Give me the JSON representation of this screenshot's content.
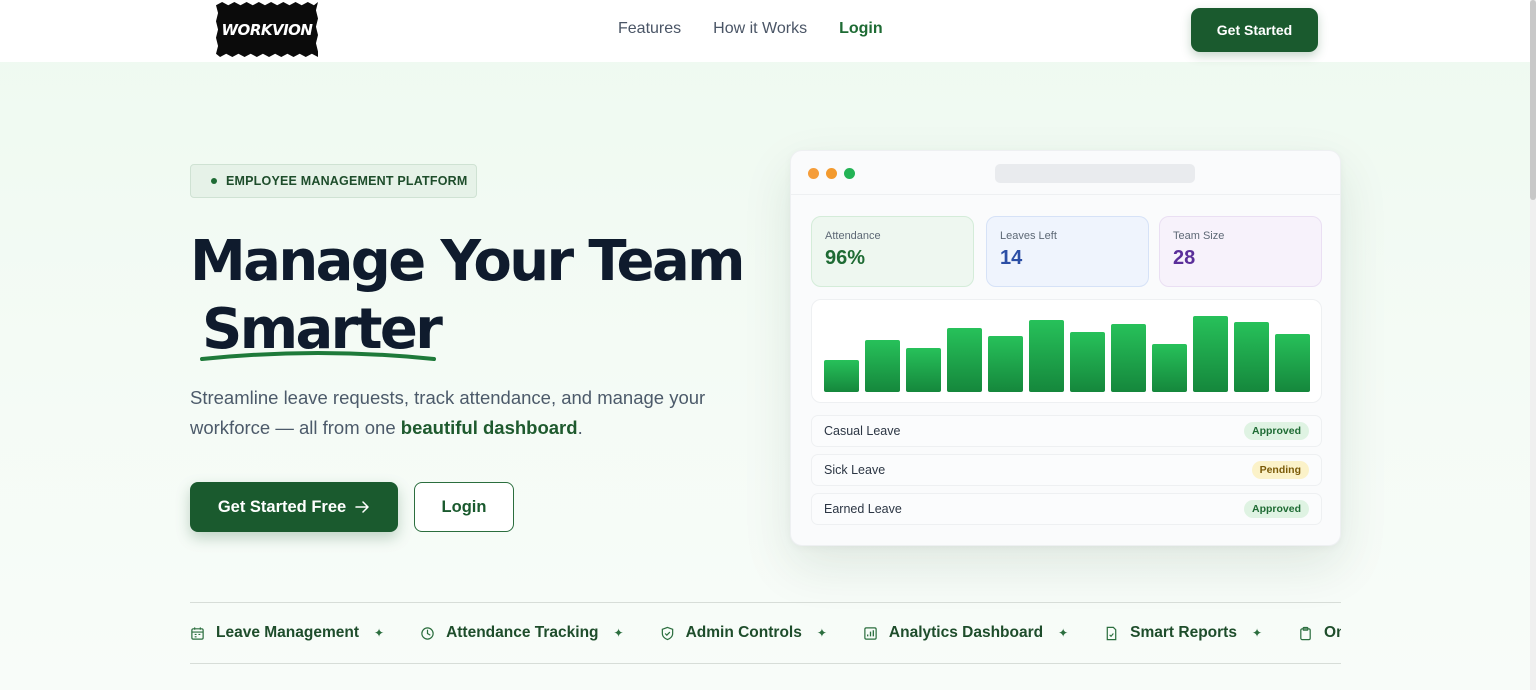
{
  "nav": {
    "logo_text": "WORKVION",
    "links": [
      "Features",
      "How it Works",
      "Login"
    ],
    "cta": "Get Started"
  },
  "hero": {
    "badge": "EMPLOYEE MANAGEMENT PLATFORM",
    "headline_line1": "Manage Your Team",
    "headline_line2": "Smarter",
    "subtext_before": "Streamline leave requests, track attendance, and manage your workforce — all from one ",
    "subtext_highlight": "beautiful dashboard",
    "subtext_after": ".",
    "cta_primary": "Get Started Free",
    "cta_secondary": "Login"
  },
  "dashboard": {
    "stats": [
      {
        "label": "Attendance",
        "value": "96%",
        "color": "#1e6b34"
      },
      {
        "label": "Leaves Left",
        "value": "14",
        "color": "#2b4ea5"
      },
      {
        "label": "Team Size",
        "value": "28",
        "color": "#5b2f9a"
      }
    ],
    "chart_data": {
      "type": "bar",
      "values": [
        32,
        52,
        44,
        64,
        56,
        72,
        60,
        68,
        48,
        76,
        70,
        58
      ],
      "ylim": [
        0,
        80
      ],
      "xlabel": "",
      "ylabel": "",
      "color": "#22a24d"
    },
    "leaves": [
      {
        "name": "Casual Leave",
        "status": "Approved"
      },
      {
        "name": "Sick Leave",
        "status": "Pending"
      },
      {
        "name": "Earned Leave",
        "status": "Approved"
      }
    ]
  },
  "features": [
    {
      "label": "Leave Management",
      "icon": "calendar-icon"
    },
    {
      "label": "Attendance Tracking",
      "icon": "clock-icon"
    },
    {
      "label": "Admin Controls",
      "icon": "shield-icon"
    },
    {
      "label": "Analytics Dashboard",
      "icon": "chart-icon"
    },
    {
      "label": "Smart Reports",
      "icon": "document-icon"
    },
    {
      "label": "One-Cl",
      "icon": "clipboard-icon"
    }
  ],
  "colors": {
    "brand": "#1a5a2e",
    "accent": "#22a24d"
  }
}
